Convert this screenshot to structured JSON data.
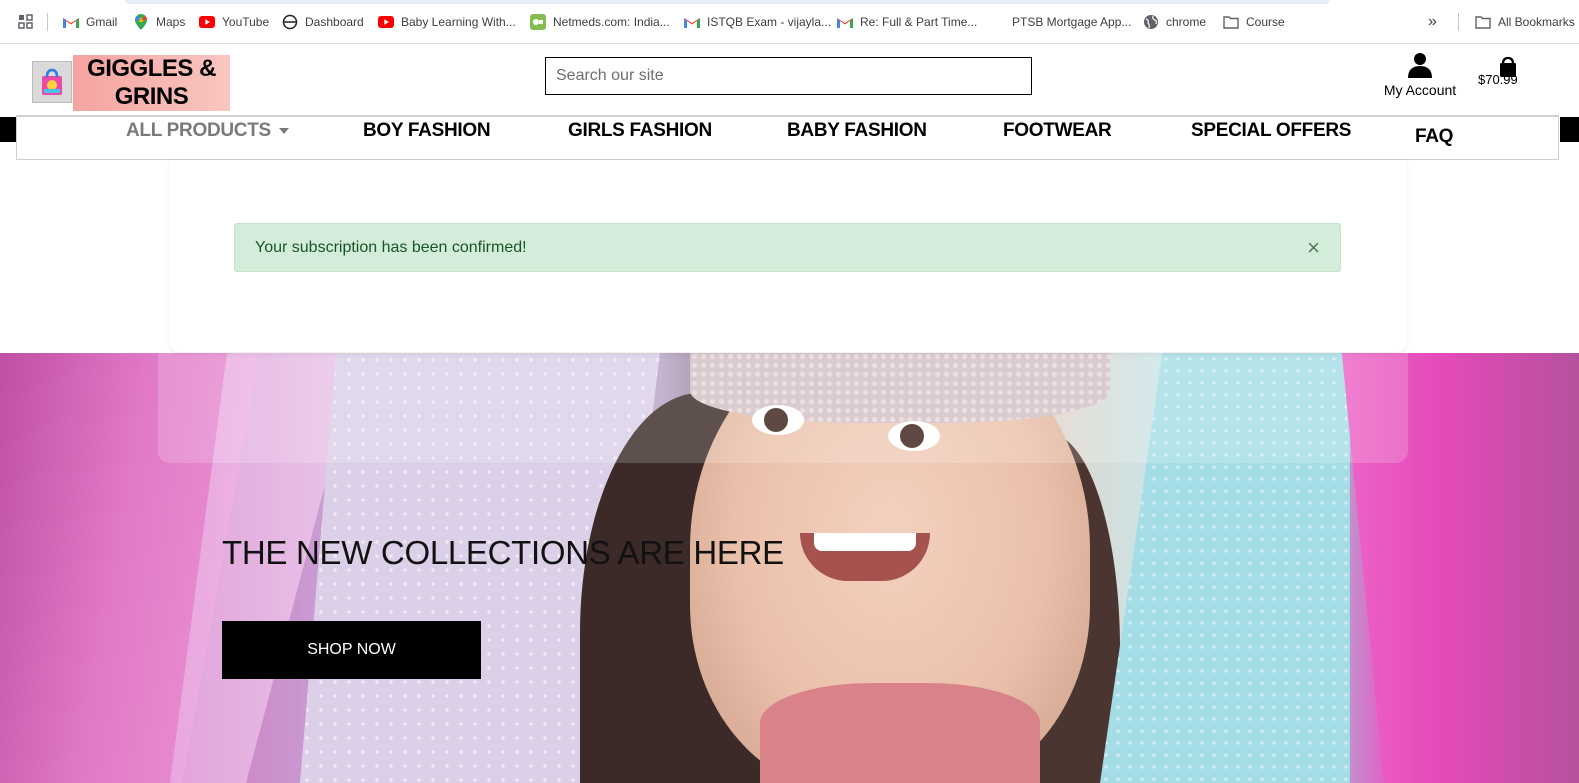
{
  "bookmarks": {
    "items": [
      {
        "label": "Gmail",
        "icon": "gmail-icon"
      },
      {
        "label": "Maps",
        "icon": "maps-icon"
      },
      {
        "label": "YouTube",
        "icon": "youtube-icon"
      },
      {
        "label": "Dashboard",
        "icon": "dashboard-icon"
      },
      {
        "label": "Baby Learning With...",
        "icon": "youtube-icon"
      },
      {
        "label": "Netmeds.com: India...",
        "icon": "netmeds-icon"
      },
      {
        "label": "ISTQB Exam - vijayla...",
        "icon": "gmail-icon"
      },
      {
        "label": "Re: Full & Part Time...",
        "icon": "gmail-icon"
      },
      {
        "label": "PTSB Mortgage App...",
        "icon": ""
      },
      {
        "label": "chrome",
        "icon": "globe-icon"
      },
      {
        "label": "Course",
        "icon": "folder-icon"
      }
    ],
    "overflow": "»",
    "all_bookmarks": "All Bookmarks"
  },
  "header": {
    "logo_text": "GIGGLES & GRINS",
    "search_placeholder": "Search our site",
    "account_label": "My Account",
    "cart_total": "$70.99"
  },
  "nav": {
    "items": [
      "ALL PRODUCTS",
      "BOY FASHION",
      "GIRLS FASHION",
      "BABY FASHION",
      "FOOTWEAR",
      "SPECIAL OFFERS",
      "FAQ"
    ]
  },
  "alert": {
    "message": "Your subscription has been confirmed!",
    "close": "×"
  },
  "hero": {
    "title": "THE NEW COLLECTIONS ARE HERE",
    "button": "SHOP NOW"
  },
  "colors": {
    "alert_bg": "#d4edda",
    "alert_text": "#155724",
    "logo_bg": "#f6a3a0",
    "button_bg": "#000000"
  }
}
